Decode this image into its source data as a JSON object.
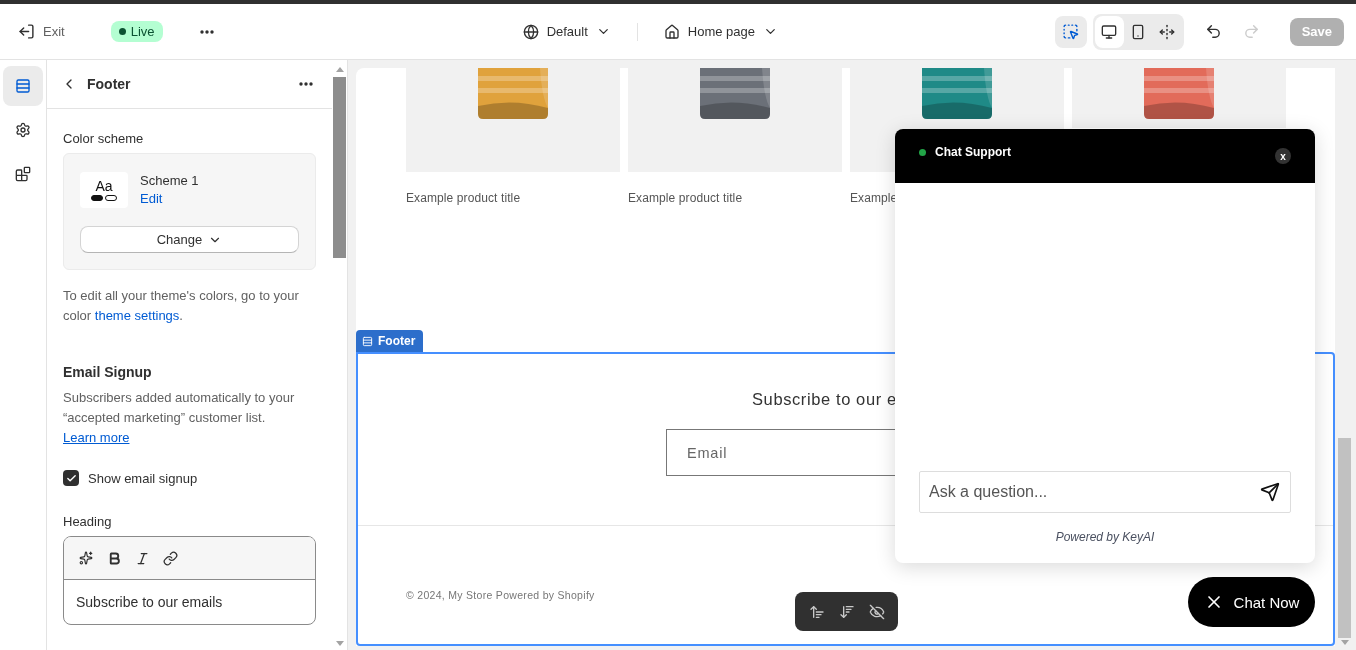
{
  "topbar": {
    "exit": "Exit",
    "status": "Live",
    "theme": "Default",
    "page": "Home page",
    "inspector": {
      "on": true
    },
    "view_modes": [
      {
        "kind": "desktop",
        "selected": true
      },
      {
        "kind": "mobile",
        "selected": false
      },
      {
        "kind": "fullwidth",
        "selected": false
      }
    ],
    "undo": {
      "disabled": false
    },
    "redo": {
      "disabled": true
    },
    "save": {
      "label": "Save",
      "disabled": true
    }
  },
  "rail": [
    {
      "kind": "sections",
      "selected": true
    },
    {
      "kind": "settings",
      "selected": false
    },
    {
      "kind": "apps",
      "selected": false
    }
  ],
  "panel": {
    "title": "Footer",
    "color_scheme": {
      "label": "Color scheme",
      "swatch": "Aa",
      "name": "Scheme 1",
      "edit": "Edit",
      "change": "Change"
    },
    "hint": {
      "before": "To edit all your theme's colors, go to your color ",
      "link": "theme settings",
      "after": "."
    },
    "email_signup": {
      "title": "Email Signup",
      "description": "Subscribers added automatically to your “accepted marketing” customer list.",
      "link": "Learn more",
      "checkbox": {
        "label": "Show email signup",
        "checked": true
      },
      "heading_label": "Heading",
      "heading_value": "Subscribe to our emails"
    }
  },
  "preview": {
    "products": [
      {
        "title": "Example product title",
        "color": "#e0a23c"
      },
      {
        "title": "Example product title",
        "color": "#6b7078"
      },
      {
        "title": "Example",
        "color": "#1f8a87"
      },
      {
        "color": "#e26b5a"
      }
    ],
    "footer": {
      "tag": "Footer",
      "heading": "Subscribe to our e",
      "email_placeholder": "Email",
      "copyright": "© 2024, My Store Powered by Shopify"
    }
  },
  "chat": {
    "title": "Chat Support",
    "online": true,
    "close": "x",
    "placeholder": "Ask a question...",
    "powered": "Powered by KeyAI",
    "launcher": "Chat Now"
  }
}
